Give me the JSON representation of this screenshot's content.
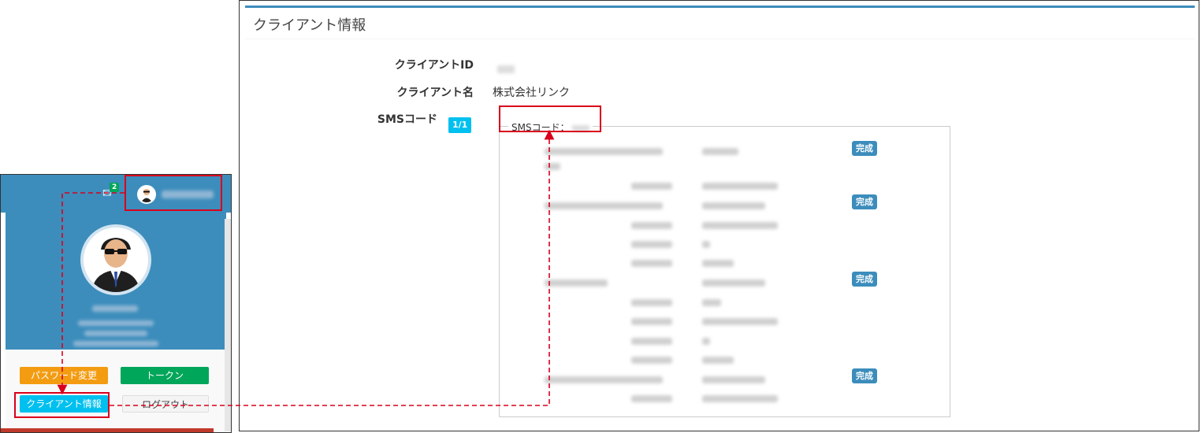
{
  "menu": {
    "mail_count": "2",
    "envelope_icon": "✉",
    "buttons": {
      "password_change": "パスワード変更",
      "token": "トークン",
      "client_info": "クライアント情報",
      "logout": "ログアウト"
    }
  },
  "client_info": {
    "title": "クライアント情報",
    "fields": {
      "client_id_label": "クライアントID",
      "client_name_label": "クライアント名",
      "client_name_value": "株式会社リンク",
      "sms_code_label": "SMSコード",
      "sms_code_badge": "1/1"
    },
    "sms_box": {
      "legend_label": "SMSコード：",
      "status_labels": [
        "完成",
        "完成",
        "完成",
        "完成"
      ]
    }
  },
  "colors": {
    "header_blue": "#3c8dbc",
    "orange": "#f39c12",
    "green": "#00a65a",
    "cyan": "#00c0ef",
    "annotation_red": "#d9001b"
  }
}
